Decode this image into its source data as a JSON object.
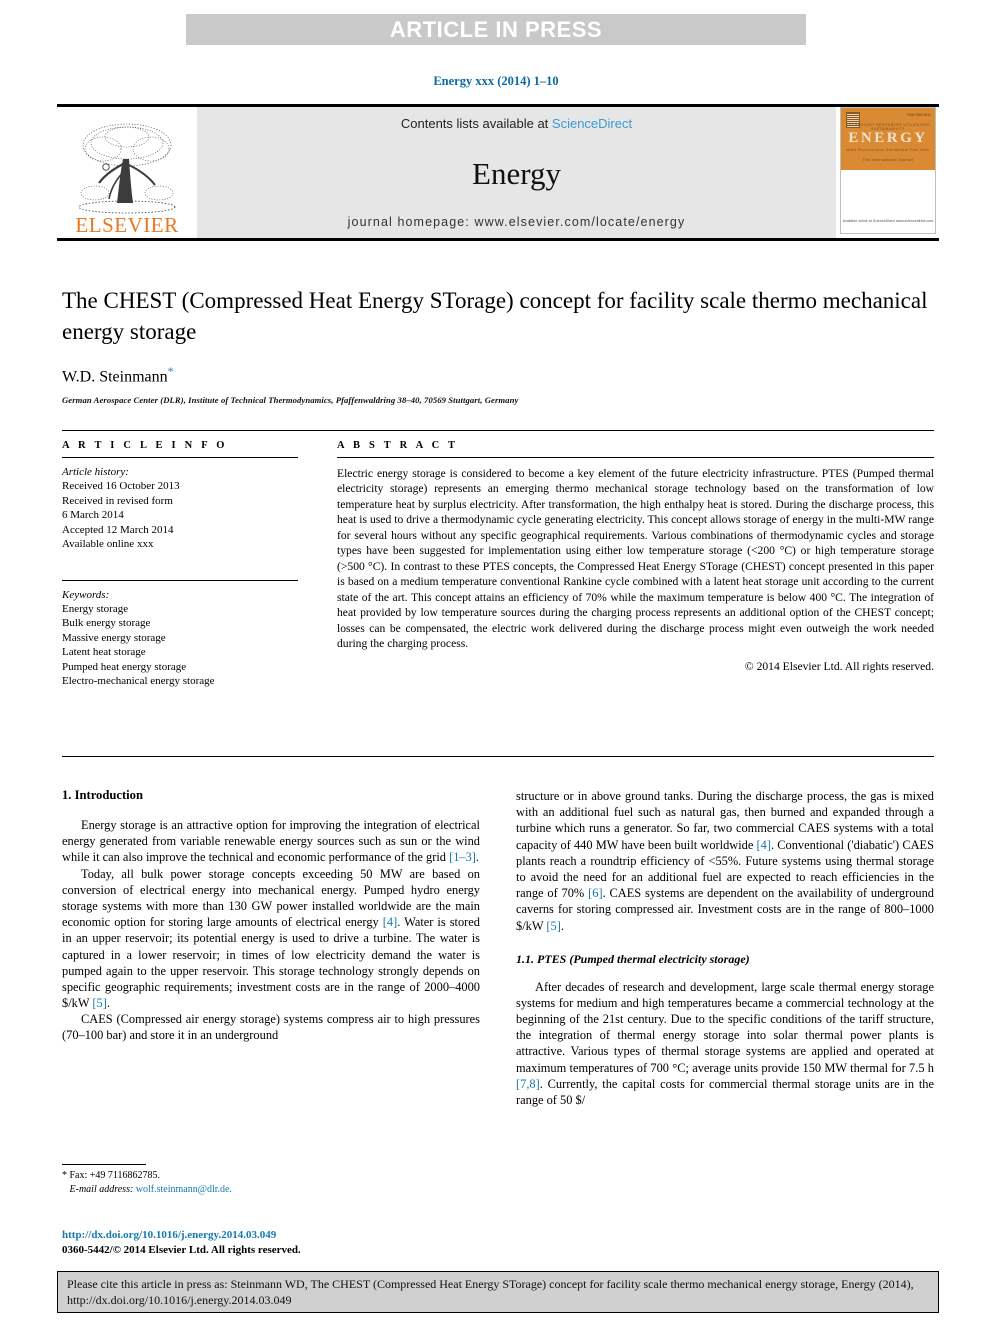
{
  "banner": {
    "text": "ARTICLE IN PRESS"
  },
  "running_citation": "Energy xxx (2014) 1–10",
  "masthead": {
    "publisher": "ELSEVIER",
    "contents_prefix": "Contents lists available at ",
    "contents_link": "ScienceDirect",
    "journal_name": "Energy",
    "homepage": "journal homepage: www.elsevier.com/locate/energy",
    "cover": {
      "title": "ENERGY",
      "line_top": "TECHNOLOGY      RESOURCES      UTILIZATION      SUSTAINABILITY",
      "line_mid": "Wind    Photovoltaics    Geothermal    Fuel cells",
      "line_sub": "The International Journal",
      "corner": "ISSN 0360-5442",
      "bottom": "Available online at\nScienceDirect\nwww.sciencedirect.com"
    }
  },
  "article": {
    "title": "The CHEST (Compressed Heat Energy STorage) concept for facility scale thermo mechanical energy storage",
    "author": "W.D. Steinmann",
    "author_marker": "*",
    "affiliation": "German Aerospace Center (DLR), Institute of Technical Thermodynamics, Pfaffenwaldring 38–40, 70569 Stuttgart, Germany"
  },
  "info": {
    "heading": "A R T I C L E   I N F O",
    "history_label": "Article history:",
    "history": [
      "Received 16 October 2013",
      "Received in revised form",
      "6 March 2014",
      "Accepted 12 March 2014",
      "Available online xxx"
    ],
    "keywords_label": "Keywords:",
    "keywords": [
      "Energy storage",
      "Bulk energy storage",
      "Massive energy storage",
      "Latent heat storage",
      "Pumped heat energy storage",
      "Electro-mechanical energy storage"
    ]
  },
  "abstract": {
    "heading": "A B S T R A C T",
    "text": "Electric energy storage is considered to become a key element of the future electricity infrastructure. PTES (Pumped thermal electricity storage) represents an emerging thermo mechanical storage technology based on the transformation of low temperature heat by surplus electricity. After transformation, the high enthalpy heat is stored. During the discharge process, this heat is used to drive a thermodynamic cycle generating electricity. This concept allows storage of energy in the multi-MW range for several hours without any specific geographical requirements. Various combinations of thermodynamic cycles and storage types have been suggested for implementation using either low temperature storage (<200 °C) or high temperature storage (>500 °C). In contrast to these PTES concepts, the Compressed Heat Energy STorage (CHEST) concept presented in this paper is based on a medium temperature conventional Rankine cycle combined with a latent heat storage unit according to the current state of the art. This concept attains an efficiency of 70% while the maximum temperature is below 400 °C. The integration of heat provided by low temperature sources during the charging process represents an additional option of the CHEST concept; losses can be compensated, the electric work delivered during the discharge process might even outweigh the work needed during the charging process.",
    "copyright": "© 2014 Elsevier Ltd. All rights reserved."
  },
  "body": {
    "section_heading": "1. Introduction",
    "left_paragraphs": [
      "Energy storage is an attractive option for improving the integration of electrical energy generated from variable renewable energy sources such as sun or the wind while it can also improve the technical and economic performance of the grid [1–3].",
      "Today, all bulk power storage concepts exceeding 50 MW are based on conversion of electrical energy into mechanical energy. Pumped hydro energy storage systems with more than 130 GW power installed worldwide are the main economic option for storing large amounts of electrical energy [4]. Water is stored in an upper reservoir; its potential energy is used to drive a turbine. The water is captured in a lower reservoir; in times of low electricity demand the water is pumped again to the upper reservoir. This storage technology strongly depends on specific geographic requirements; investment costs are in the range of 2000–4000 $/kW [5].",
      "CAES (Compressed air energy storage) systems compress air to high pressures (70–100 bar) and store it in an underground"
    ],
    "right_paragraphs": [
      "structure or in above ground tanks. During the discharge process, the gas is mixed with an additional fuel such as natural gas, then burned and expanded through a turbine which runs a generator. So far, two commercial CAES systems with a total capacity of 440 MW have been built worldwide [4]. Conventional ('diabatic') CAES plants reach a roundtrip efficiency of <55%. Future systems using thermal storage to avoid the need for an additional fuel are expected to reach efficiencies in the range of 70% [6]. CAES systems are dependent on the availability of underground caverns for storing compressed air. Investment costs are in the range of 800–1000 $/kW [5]."
    ],
    "subsection_heading": "1.1. PTES (Pumped thermal electricity storage)",
    "right_paragraphs_2": [
      "After decades of research and development, large scale thermal energy storage systems for medium and high temperatures became a commercial technology at the beginning of the 21st century. Due to the specific conditions of the tariff structure, the integration of thermal energy storage into solar thermal power plants is attractive. Various types of thermal storage systems are applied and operated at maximum temperatures of 700 °C; average units provide 150 MW thermal for 7.5 h [7,8]. Currently, the capital costs for commercial thermal storage units are in the range of 50 $/"
    ]
  },
  "footnote": {
    "fax": "* Fax: +49 7116862785.",
    "email_label": "E-mail address:",
    "email": "wolf.steinmann@dlr.de.",
    "doi": "http://dx.doi.org/10.1016/j.energy.2014.03.049",
    "issn": "0360-5442/© 2014 Elsevier Ltd. All rights reserved."
  },
  "cite_box": {
    "text": "Please cite this article in press as: Steinmann WD, The CHEST (Compressed Heat Energy STorage) concept for facility scale thermo mechanical energy storage, Energy (2014), http://dx.doi.org/10.1016/j.energy.2014.03.049"
  },
  "colors": {
    "link": "#1579b0",
    "sciencedirect": "#3a9bd0",
    "elsevier_orange": "#e87722",
    "banner_bg": "#c9c9c9",
    "masthead_bg": "#e6e6e6",
    "cite_bg": "#d0d0d0"
  }
}
